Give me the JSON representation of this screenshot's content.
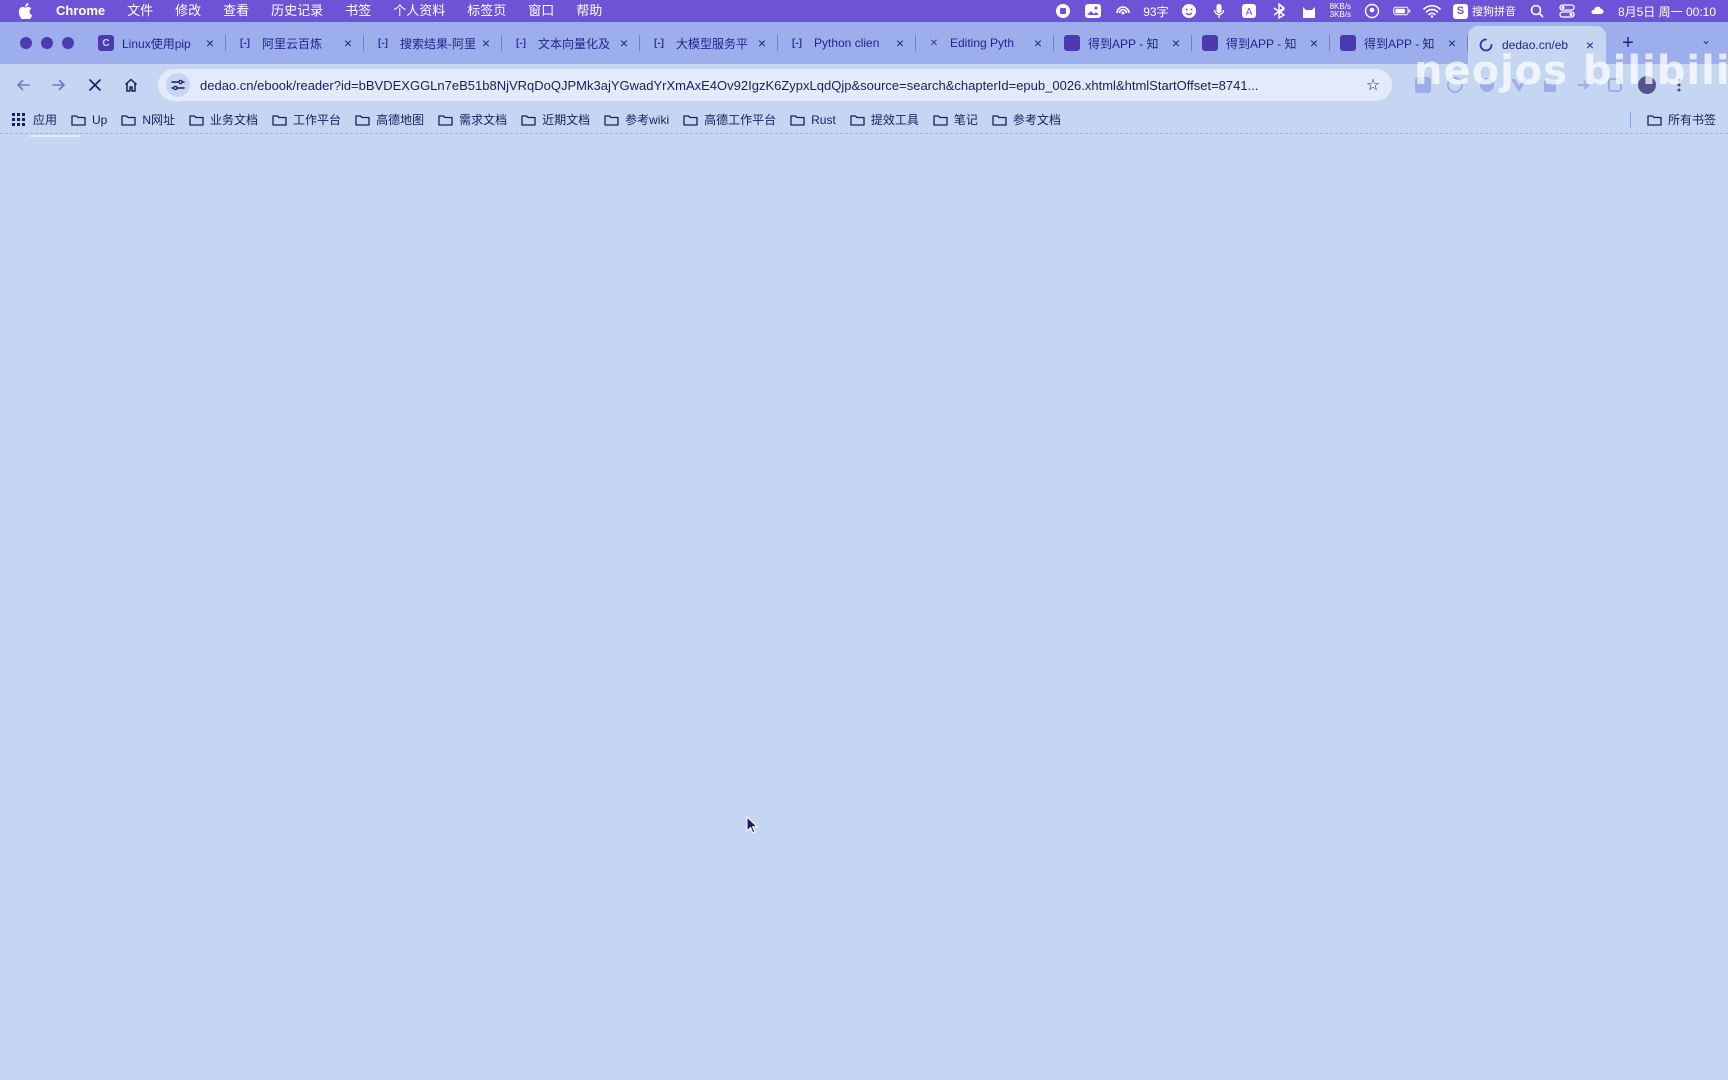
{
  "menubar": {
    "app_name": "Chrome",
    "menus": [
      "文件",
      "修改",
      "查看",
      "历史记录",
      "书签",
      "个人资料",
      "标签页",
      "窗口",
      "帮助"
    ],
    "word_count": "93字",
    "net_up": "8KB/s",
    "net_down": "3KB/s",
    "ime_label": "搜狗拼音",
    "ime_badge": "S",
    "clock": "8月5日 周一  00:10"
  },
  "tabs": [
    {
      "title": "Linux使用pip",
      "favicon": "C"
    },
    {
      "title": "阿里云百炼",
      "favicon": "[-]"
    },
    {
      "title": "搜索结果-阿里",
      "favicon": "[-]"
    },
    {
      "title": "文本向量化及",
      "favicon": "[-]"
    },
    {
      "title": "大模型服务平",
      "favicon": "[-]"
    },
    {
      "title": "Python clien",
      "favicon": "[-]"
    },
    {
      "title": "Editing Pyth",
      "favicon": "✕"
    },
    {
      "title": "得到APP - 知",
      "favicon": ""
    },
    {
      "title": "得到APP - 知",
      "favicon": ""
    },
    {
      "title": "得到APP - 知",
      "favicon": ""
    }
  ],
  "active_tab": {
    "title": "dedao.cn/eb",
    "close": "×"
  },
  "tab_close": "×",
  "new_tab": "+",
  "tab_search": "⌄",
  "toolbar": {
    "back": "←",
    "forward": "→",
    "stop": "✕",
    "home": "⌂",
    "url": "dedao.cn/ebook/reader?id=bBVDEXGGLn7eB51b8NjVRqDoQJPMk3ajYGwadYrXmAxE4Ov92IgzK6ZypxLqdQjp&source=search&chapterId=epub_0026.xhtml&htmlStartOffset=8741...",
    "star": "☆"
  },
  "watermark": "neojos bilibili",
  "bookmarks": [
    {
      "label": "应用",
      "icon": "apps-grid-icon"
    },
    {
      "label": "Up",
      "icon": "folder-icon"
    },
    {
      "label": "N网址",
      "icon": "folder-icon"
    },
    {
      "label": "业务文档",
      "icon": "folder-icon"
    },
    {
      "label": "工作平台",
      "icon": "folder-icon"
    },
    {
      "label": "高德地图",
      "icon": "folder-icon"
    },
    {
      "label": "需求文档",
      "icon": "folder-icon"
    },
    {
      "label": "近期文档",
      "icon": "folder-icon"
    },
    {
      "label": "参考wiki",
      "icon": "folder-icon"
    },
    {
      "label": "高德工作平台",
      "icon": "folder-icon"
    },
    {
      "label": "Rust",
      "icon": "folder-icon"
    },
    {
      "label": "提效工具",
      "icon": "folder-icon"
    },
    {
      "label": "笔记",
      "icon": "folder-icon"
    },
    {
      "label": "参考文档",
      "icon": "folder-icon"
    }
  ],
  "all_bookmarks": "所有书签",
  "colors": {
    "menubar": "#6b55d6",
    "tabstrip": "#9daeed",
    "content": "#c5d6f2",
    "text": "#1c1d5c"
  }
}
